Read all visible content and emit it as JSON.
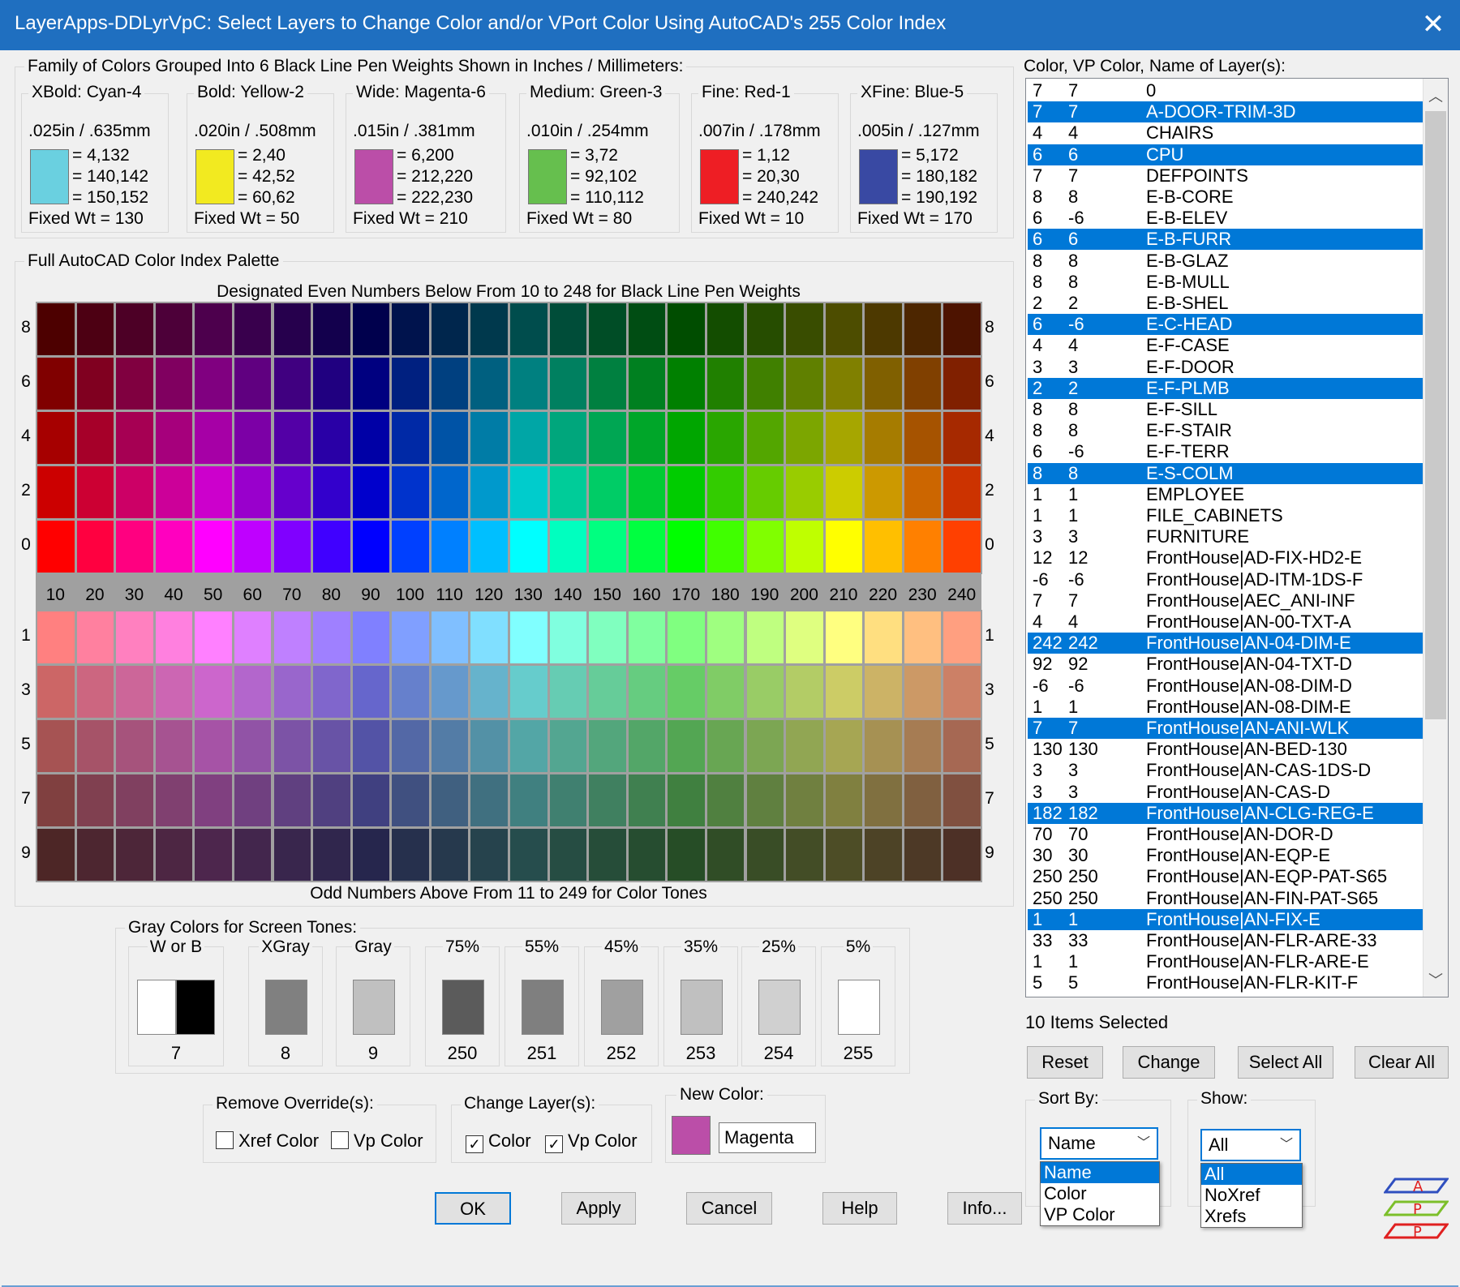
{
  "window": {
    "title": "LayerApps-DDLyrVpC: Select Layers to Change Color and/or VPort Color Using AutoCAD's 255 Color Index",
    "close_glyph": "✕"
  },
  "family": {
    "group_label": "Family of Colors Grouped Into 6 Black Line Pen Weights Shown in Inches / Millimeters:",
    "items": [
      {
        "title": "XBold: Cyan-4",
        "size": ".025in / .635mm",
        "nums": [
          "= 4,132",
          "= 140,142",
          "= 150,152"
        ],
        "weight": "Fixed Wt = 130",
        "color": "#6ad0e0"
      },
      {
        "title": "Bold: Yellow-2",
        "size": ".020in / .508mm",
        "nums": [
          "= 2,40",
          "= 42,52",
          "= 60,62"
        ],
        "weight": "Fixed Wt = 50",
        "color": "#f2ea20"
      },
      {
        "title": "Wide: Magenta-6",
        "size": ".015in / .381mm",
        "nums": [
          "= 6,200",
          "= 212,220",
          "= 222,230"
        ],
        "weight": "Fixed Wt = 210",
        "color": "#bb4ea8"
      },
      {
        "title": "Medium: Green-3",
        "size": ".010in / .254mm",
        "nums": [
          "= 3,72",
          "= 92,102",
          "= 110,112"
        ],
        "weight": "Fixed Wt = 80",
        "color": "#66bf4e"
      },
      {
        "title": "Fine: Red-1",
        "size": ".007in / .178mm",
        "nums": [
          "= 1,12",
          "= 20,30",
          "= 240,242"
        ],
        "weight": "Fixed Wt = 10",
        "color": "#ee1e24"
      },
      {
        "title": "XFine: Blue-5",
        "size": ".005in / .127mm",
        "nums": [
          "= 5,172",
          "= 180,182",
          "= 190,192"
        ],
        "weight": "Fixed Wt = 170",
        "color": "#3949a3"
      }
    ]
  },
  "palette": {
    "group_label": "Full AutoCAD Color Index Palette",
    "top_caption": "Designated Even Numbers Below From 10 to 248 for Black Line Pen Weights",
    "bottom_caption": "Odd Numbers Above From 11 to 249 for Color Tones",
    "hue_labels": [
      "10",
      "20",
      "30",
      "40",
      "50",
      "60",
      "70",
      "80",
      "90",
      "100",
      "110",
      "120",
      "130",
      "140",
      "150",
      "160",
      "170",
      "180",
      "190",
      "200",
      "210",
      "220",
      "230",
      "240"
    ],
    "even_rows": [
      "8",
      "6",
      "4",
      "2",
      "0"
    ],
    "odd_rows": [
      "1",
      "3",
      "5",
      "7",
      "9"
    ]
  },
  "gray": {
    "group_label": "Gray Colors for Screen Tones:",
    "items": [
      {
        "label": "W or B",
        "num": "7",
        "colors": [
          "#ffffff",
          "#000000"
        ]
      },
      {
        "label": "XGray",
        "num": "8",
        "colors": [
          "#808080"
        ]
      },
      {
        "label": "Gray",
        "num": "9",
        "colors": [
          "#c0c0c0"
        ]
      },
      {
        "label": "75%",
        "num": "250",
        "colors": [
          "#5b5b5b"
        ]
      },
      {
        "label": "55%",
        "num": "251",
        "colors": [
          "#7f7f7f"
        ]
      },
      {
        "label": "45%",
        "num": "252",
        "colors": [
          "#a0a0a0"
        ]
      },
      {
        "label": "35%",
        "num": "253",
        "colors": [
          "#c0c0c0"
        ]
      },
      {
        "label": "25%",
        "num": "254",
        "colors": [
          "#d0d0d0"
        ]
      },
      {
        "label": "5%",
        "num": "255",
        "colors": [
          "#ffffff"
        ]
      }
    ]
  },
  "remove_override": {
    "label": "Remove Override(s):",
    "xref": "Xref Color",
    "vp": "Vp Color"
  },
  "change_layers": {
    "label": "Change Layer(s):",
    "color": "Color",
    "vp": "Vp Color",
    "check_glyph": "✓"
  },
  "new_color": {
    "label": "New Color:",
    "value": "Magenta",
    "color": "#bb4ea8"
  },
  "buttons": {
    "ok": "OK",
    "apply": "Apply",
    "cancel": "Cancel",
    "help": "Help",
    "info": "Info..."
  },
  "layers": {
    "label": "Color, VP Color, Name of Layer(s):",
    "scroll_up": "︿",
    "scroll_down": "﹀",
    "rows": [
      [
        "7",
        "7",
        "0",
        false
      ],
      [
        "7",
        "7",
        "A-DOOR-TRIM-3D",
        true
      ],
      [
        "4",
        "4",
        "CHAIRS",
        false
      ],
      [
        "6",
        "6",
        "CPU",
        true
      ],
      [
        "7",
        "7",
        "DEFPOINTS",
        false
      ],
      [
        "8",
        "8",
        "E-B-CORE",
        false
      ],
      [
        "6",
        "-6",
        "E-B-ELEV",
        false
      ],
      [
        "6",
        "6",
        "E-B-FURR",
        true
      ],
      [
        "8",
        "8",
        "E-B-GLAZ",
        false
      ],
      [
        "8",
        "8",
        "E-B-MULL",
        false
      ],
      [
        "2",
        "2",
        "E-B-SHEL",
        false
      ],
      [
        "6",
        "-6",
        "E-C-HEAD",
        true
      ],
      [
        "4",
        "4",
        "E-F-CASE",
        false
      ],
      [
        "3",
        "3",
        "E-F-DOOR",
        false
      ],
      [
        "2",
        "2",
        "E-F-PLMB",
        true
      ],
      [
        "8",
        "8",
        "E-F-SILL",
        false
      ],
      [
        "8",
        "8",
        "E-F-STAIR",
        false
      ],
      [
        "6",
        "-6",
        "E-F-TERR",
        false
      ],
      [
        "8",
        "8",
        "E-S-COLM",
        true
      ],
      [
        "1",
        "1",
        "EMPLOYEE",
        false
      ],
      [
        "1",
        "1",
        "FILE_CABINETS",
        false
      ],
      [
        "3",
        "3",
        "FURNITURE",
        false
      ],
      [
        "12",
        "12",
        "FrontHouse|AD-FIX-HD2-E",
        false
      ],
      [
        "-6",
        "-6",
        "FrontHouse|AD-ITM-1DS-F",
        false
      ],
      [
        "7",
        "7",
        "FrontHouse|AEC_ANI-INF",
        false
      ],
      [
        "4",
        "4",
        "FrontHouse|AN-00-TXT-A",
        false
      ],
      [
        "242",
        "242",
        "FrontHouse|AN-04-DIM-E",
        true
      ],
      [
        "92",
        "92",
        "FrontHouse|AN-04-TXT-D",
        false
      ],
      [
        "-6",
        "-6",
        "FrontHouse|AN-08-DIM-D",
        false
      ],
      [
        "1",
        "1",
        "FrontHouse|AN-08-DIM-E",
        false
      ],
      [
        "7",
        "7",
        "FrontHouse|AN-ANI-WLK",
        true
      ],
      [
        "130",
        "130",
        "FrontHouse|AN-BED-130",
        false
      ],
      [
        "3",
        "3",
        "FrontHouse|AN-CAS-1DS-D",
        false
      ],
      [
        "3",
        "3",
        "FrontHouse|AN-CAS-D",
        false
      ],
      [
        "182",
        "182",
        "FrontHouse|AN-CLG-REG-E",
        true
      ],
      [
        "70",
        "70",
        "FrontHouse|AN-DOR-D",
        false
      ],
      [
        "30",
        "30",
        "FrontHouse|AN-EQP-E",
        false
      ],
      [
        "250",
        "250",
        "FrontHouse|AN-EQP-PAT-S65",
        false
      ],
      [
        "250",
        "250",
        "FrontHouse|AN-FIN-PAT-S65",
        false
      ],
      [
        "1",
        "1",
        "FrontHouse|AN-FIX-E",
        true
      ],
      [
        "33",
        "33",
        "FrontHouse|AN-FLR-ARE-33",
        false
      ],
      [
        "1",
        "1",
        "FrontHouse|AN-FLR-ARE-E",
        false
      ],
      [
        "5",
        "5",
        "FrontHouse|AN-FLR-KIT-F",
        false
      ]
    ]
  },
  "status": {
    "selected_text": "10 Items Selected"
  },
  "list_buttons": {
    "reset": "Reset",
    "change": "Change",
    "select_all": "Select All",
    "clear_all": "Clear All"
  },
  "sort_by": {
    "label": "Sort By:",
    "value": "Name",
    "options": [
      "Name",
      "Color",
      "VP Color"
    ]
  },
  "show": {
    "label": "Show:",
    "value": "All",
    "options": [
      "All",
      "NoXref",
      "Xrefs"
    ]
  },
  "logo": {
    "letters": [
      "A",
      "P",
      "P"
    ]
  },
  "combo_arrow": "﹀"
}
